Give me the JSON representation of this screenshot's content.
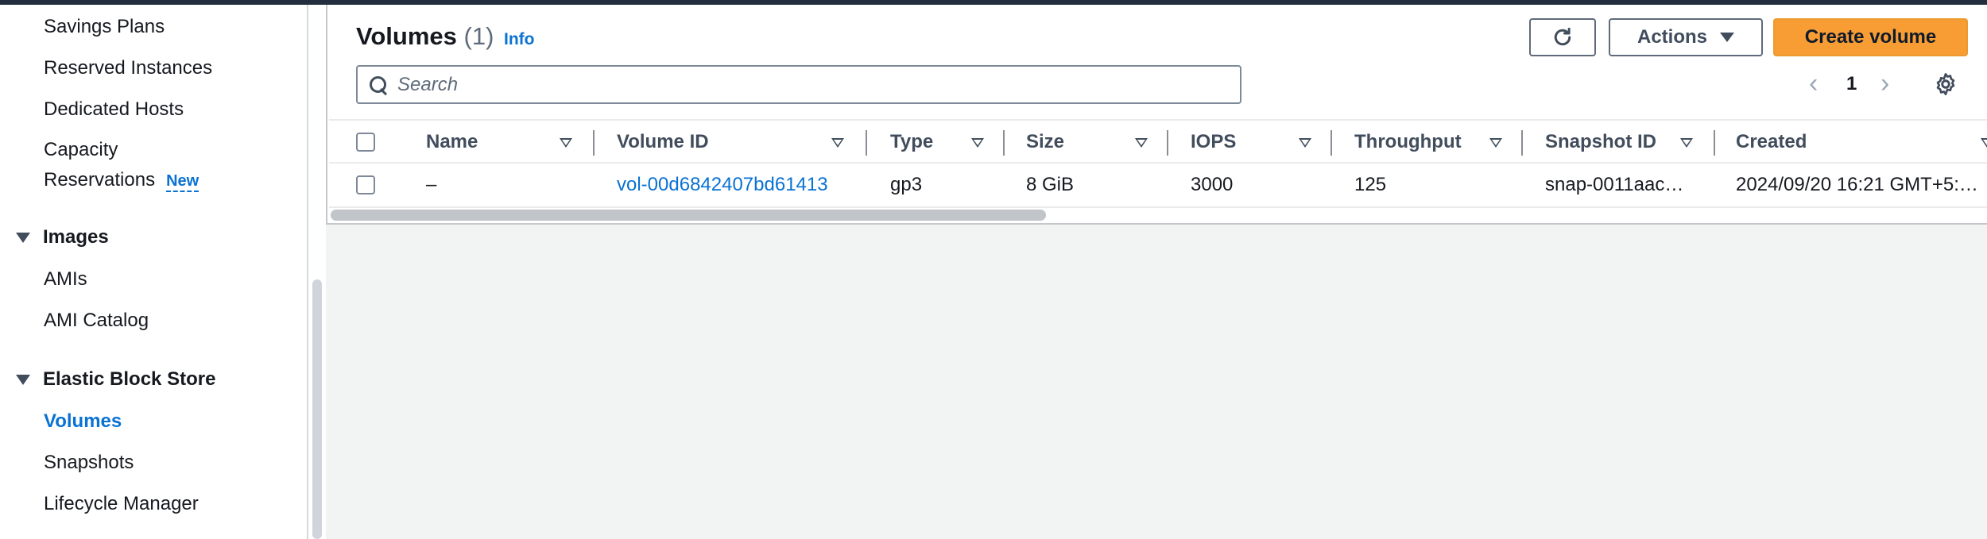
{
  "sidebar": {
    "items_top": [
      "Savings Plans",
      "Reserved Instances",
      "Dedicated Hosts"
    ],
    "capacity_line1": "Capacity",
    "capacity_line2": "Reservations",
    "capacity_badge": "New",
    "group_images": "Images",
    "images_items": [
      "AMIs",
      "AMI Catalog"
    ],
    "group_ebs": "Elastic Block Store",
    "ebs_items": [
      "Volumes",
      "Snapshots",
      "Lifecycle Manager"
    ],
    "active_item": "Volumes"
  },
  "header": {
    "title": "Volumes",
    "count": "(1)",
    "info": "Info",
    "actions_label": "Actions",
    "create_label": "Create volume",
    "refresh_icon": "refresh-icon"
  },
  "search": {
    "placeholder": "Search",
    "value": ""
  },
  "pagination": {
    "prev": "‹",
    "page": "1",
    "next": "›"
  },
  "table": {
    "columns": [
      "Name",
      "Volume ID",
      "Type",
      "Size",
      "IOPS",
      "Throughput",
      "Snapshot ID",
      "Created"
    ],
    "rows": [
      {
        "name": "–",
        "volume_id": "vol-00d6842407bd61413",
        "type": "gp3",
        "size": "8 GiB",
        "iops": "3000",
        "throughput": "125",
        "snapshot_id": "snap-0011aac…",
        "created": "2024/09/20 16:21 GMT+5:…"
      }
    ]
  },
  "colors": {
    "accent_link": "#0972d3",
    "primary_button": "#f89c34",
    "topbar": "#232f3e"
  }
}
